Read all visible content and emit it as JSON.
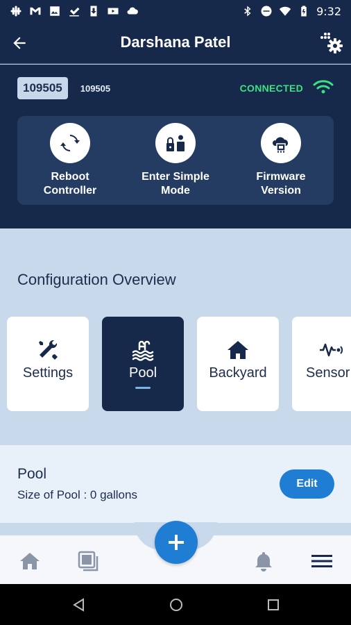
{
  "status_bar": {
    "time": "9:32",
    "left_icons": [
      "slack-icon",
      "gmail-icon",
      "image-icon",
      "check-icon",
      "download-icon",
      "youtube-icon",
      "cloud-icon"
    ],
    "right_icons": [
      "bluetooth-icon",
      "do-not-disturb-icon",
      "wifi-icon",
      "battery-icon"
    ]
  },
  "app_bar": {
    "title": "Darshana Patel",
    "back_icon": "arrow-left-icon",
    "settings_icon": "gear-icon"
  },
  "controller": {
    "badge": "109505",
    "id": "109505",
    "status": "CONNECTED",
    "status_color": "#3ee084"
  },
  "actions": [
    {
      "label": "Reboot\nController",
      "icon": "reboot-icon"
    },
    {
      "label": "Enter Simple\nMode",
      "icon": "simple-mode-icon"
    },
    {
      "label": "Firmware\nVersion",
      "icon": "firmware-icon"
    }
  ],
  "overview": {
    "title": "Configuration Overview",
    "cards": [
      {
        "label": "Settings",
        "icon": "tools-icon",
        "active": false
      },
      {
        "label": "Pool",
        "icon": "pool-icon",
        "active": true
      },
      {
        "label": "Backyard",
        "icon": "home-icon",
        "active": false
      },
      {
        "label": "Sensor",
        "icon": "sensor-icon",
        "active": false
      }
    ]
  },
  "pool": {
    "title": "Pool",
    "size": "Size of Pool : 0 gallons",
    "edit_label": "Edit"
  },
  "bottom_nav": {
    "items": [
      "home-icon",
      "layout-icon",
      "add-icon",
      "bell-icon",
      "menu-icon"
    ]
  },
  "colors": {
    "navy": "#17294a",
    "accent_blue": "#1f7dd4",
    "background": "#c9d9ec"
  }
}
